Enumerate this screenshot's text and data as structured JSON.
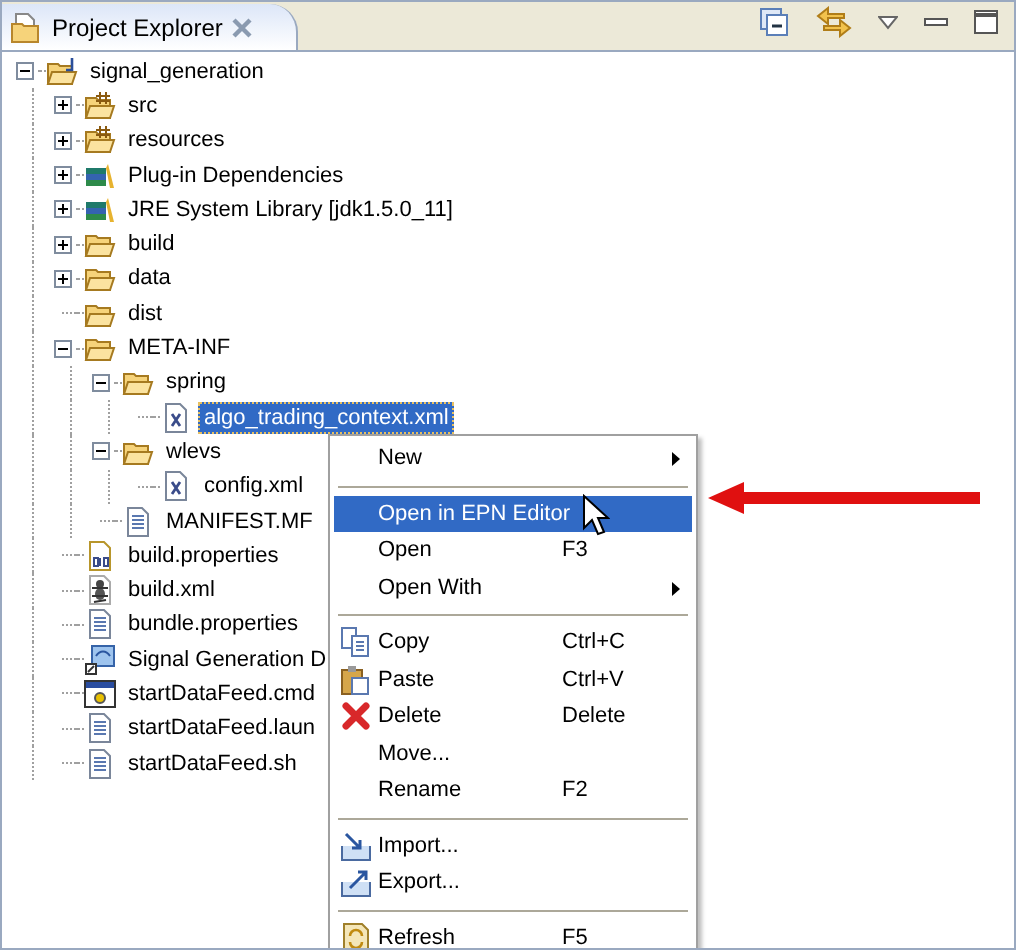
{
  "view": {
    "title": "Project Explorer"
  },
  "tree": [
    {
      "label": "signal_generation",
      "kind": "project",
      "expanded": true,
      "selected": false,
      "children": [
        {
          "label": "src",
          "kind": "source-folder",
          "expanded": false,
          "selected": false
        },
        {
          "label": "resources",
          "kind": "source-folder",
          "expanded": false,
          "selected": false
        },
        {
          "label": "Plug-in Dependencies",
          "kind": "library",
          "expanded": false,
          "selected": false
        },
        {
          "label": "JRE System Library [jdk1.5.0_11]",
          "kind": "library",
          "expanded": false,
          "selected": false
        },
        {
          "label": "build",
          "kind": "folder",
          "expanded": false,
          "selected": false
        },
        {
          "label": "data",
          "kind": "folder",
          "expanded": false,
          "selected": false
        },
        {
          "label": "dist",
          "kind": "folder",
          "selected": false
        },
        {
          "label": "META-INF",
          "kind": "folder",
          "expanded": true,
          "selected": false,
          "children": [
            {
              "label": "spring",
              "kind": "folder",
              "expanded": true,
              "selected": false,
              "children": [
                {
                  "label": "algo_trading_context.xml",
                  "kind": "xml-file",
                  "selected": true
                }
              ]
            },
            {
              "label": "wlevs",
              "kind": "folder",
              "expanded": true,
              "selected": false,
              "children": [
                {
                  "label": "config.xml",
                  "kind": "xml-file",
                  "selected": false
                }
              ]
            },
            {
              "label": "MANIFEST.MF",
              "kind": "text-file",
              "selected": false
            }
          ]
        },
        {
          "label": "build.properties",
          "kind": "binary-file",
          "selected": false
        },
        {
          "label": "build.xml",
          "kind": "ant-file",
          "selected": false
        },
        {
          "label": "bundle.properties",
          "kind": "text-file",
          "selected": false
        },
        {
          "label": "Signal Generation D",
          "kind": "app-file",
          "selected": false
        },
        {
          "label": "startDataFeed.cmd",
          "kind": "cmd-file",
          "selected": false
        },
        {
          "label": "startDataFeed.laun",
          "kind": "text-file",
          "selected": false
        },
        {
          "label": "startDataFeed.sh",
          "kind": "text-file",
          "selected": false
        }
      ]
    }
  ],
  "context_menu": {
    "items": [
      {
        "kind": "plain",
        "label": "New",
        "submenu": true,
        "selected": false
      },
      {
        "kind": "separator"
      },
      {
        "kind": "plain",
        "label": "Open in EPN Editor",
        "selected": true
      },
      {
        "kind": "plain",
        "label": "Open",
        "shortcut": "F3",
        "selected": false
      },
      {
        "kind": "plain",
        "label": "Open With",
        "submenu": true,
        "selected": false
      },
      {
        "kind": "separator"
      },
      {
        "kind": "copy",
        "label": "Copy",
        "shortcut": "Ctrl+C",
        "selected": false
      },
      {
        "kind": "paste",
        "label": "Paste",
        "shortcut": "Ctrl+V",
        "selected": false
      },
      {
        "kind": "delete",
        "label": "Delete",
        "shortcut": "Delete",
        "selected": false
      },
      {
        "kind": "plain",
        "label": "Move...",
        "selected": false
      },
      {
        "kind": "plain",
        "label": "Rename",
        "shortcut": "F2",
        "selected": false
      },
      {
        "kind": "separator"
      },
      {
        "kind": "import",
        "label": "Import...",
        "selected": false
      },
      {
        "kind": "export",
        "label": "Export...",
        "selected": false
      },
      {
        "kind": "separator"
      },
      {
        "kind": "refresh",
        "label": "Refresh",
        "shortcut": "F5",
        "selected": false
      }
    ]
  }
}
